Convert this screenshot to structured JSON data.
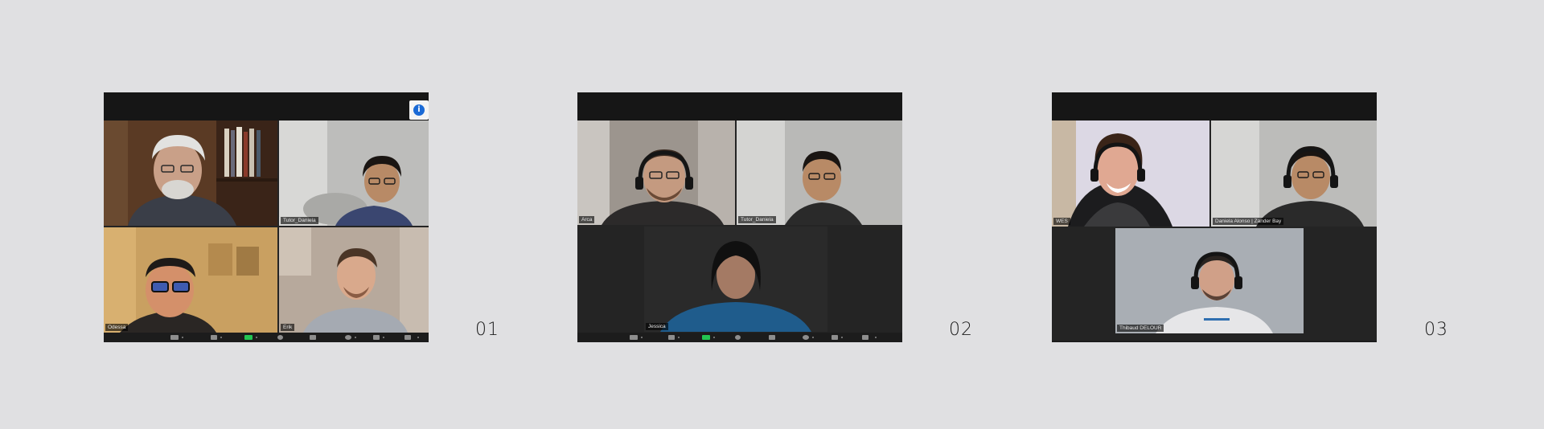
{
  "colors": {
    "background": "#e0e0e2",
    "active_speaker_border": "#b6dd5a",
    "share_button": "#23c552",
    "info_icon": "#1a6ad6"
  },
  "panels": [
    {
      "label": "01",
      "info_icon": "i",
      "participants": [
        {
          "name": ""
        },
        {
          "name": "Tutor_Daniela"
        },
        {
          "name": "Odessa"
        },
        {
          "name": "Erik"
        }
      ]
    },
    {
      "label": "02",
      "participants": [
        {
          "name": "Arca"
        },
        {
          "name": "Tutor_Daniela"
        },
        {
          "name": "Jessica"
        }
      ]
    },
    {
      "label": "03",
      "participants": [
        {
          "name": "WES"
        },
        {
          "name": "Daniela Alonso | Zander Bay"
        },
        {
          "name": "Thibaud DELOUR"
        }
      ]
    }
  ]
}
